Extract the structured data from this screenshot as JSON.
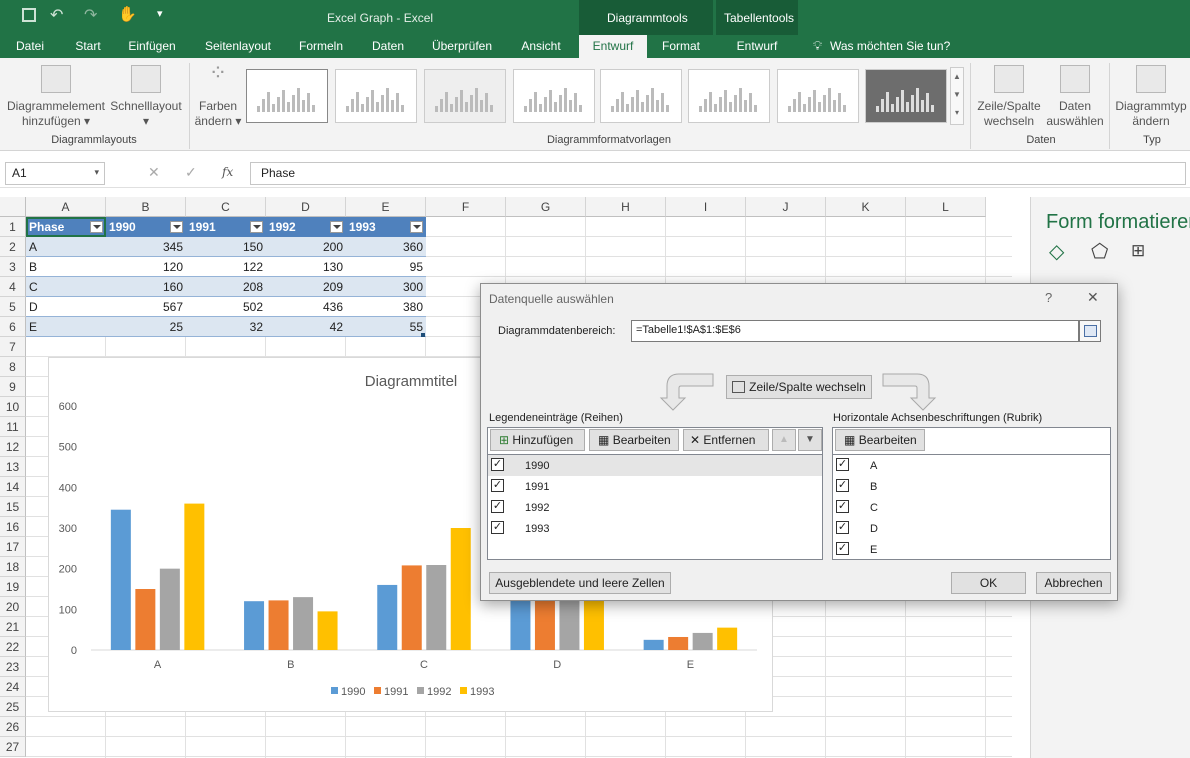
{
  "titlebar": {
    "doc_title": "Excel Graph - Excel",
    "ctx_diagram": "Diagrammtools",
    "ctx_table": "Tabellentools"
  },
  "tabs": [
    "Datei",
    "Start",
    "Einfügen",
    "Seitenlayout",
    "Formeln",
    "Daten",
    "Überprüfen",
    "Ansicht",
    "Entwurf",
    "Format",
    "Entwurf"
  ],
  "search": "Was möchten Sie tun?",
  "ribbon": {
    "add_element": "Diagrammelement",
    "add_element2": "hinzufügen",
    "quick_layout": "Schnelllayout",
    "group_layouts": "Diagrammlayouts",
    "colors": "Farben",
    "colors2": "ändern",
    "group_styles": "Diagrammformatvorlagen",
    "switch_rc": "Zeile/Spalte",
    "switch_rc2": "wechseln",
    "select_data": "Daten",
    "select_data2": "auswählen",
    "group_data": "Daten",
    "change_type": "Diagrammtyp",
    "change_type2": "ändern",
    "group_type": "Typ"
  },
  "formula": {
    "namebox": "A1",
    "fx": "fx",
    "value": "Phase"
  },
  "columns": [
    "A",
    "B",
    "C",
    "D",
    "E",
    "F",
    "G",
    "H",
    "I",
    "J",
    "K",
    "L"
  ],
  "rows": [
    "1",
    "2",
    "3",
    "4",
    "5",
    "6",
    "7",
    "8",
    "9",
    "10",
    "11",
    "12",
    "13",
    "14",
    "15",
    "16",
    "17",
    "18",
    "19",
    "20",
    "21",
    "22",
    "23",
    "24",
    "25",
    "26",
    "27"
  ],
  "table": {
    "headers": [
      "Phase",
      "1990",
      "1991",
      "1992",
      "1993"
    ],
    "rows": [
      [
        "A",
        "345",
        "150",
        "200",
        "360"
      ],
      [
        "B",
        "120",
        "122",
        "130",
        "95"
      ],
      [
        "C",
        "160",
        "208",
        "209",
        "300"
      ],
      [
        "D",
        "567",
        "502",
        "436",
        "380"
      ],
      [
        "E",
        "25",
        "32",
        "42",
        "55"
      ]
    ]
  },
  "chart_data": {
    "type": "bar",
    "title": "Diagrammtitel",
    "categories": [
      "A",
      "B",
      "C",
      "D",
      "E"
    ],
    "series": [
      {
        "name": "1990",
        "color": "#5b9bd5",
        "values": [
          345,
          120,
          160,
          567,
          25
        ]
      },
      {
        "name": "1991",
        "color": "#ed7d31",
        "values": [
          150,
          122,
          208,
          502,
          32
        ]
      },
      {
        "name": "1992",
        "color": "#a5a5a5",
        "values": [
          200,
          130,
          209,
          436,
          42
        ]
      },
      {
        "name": "1993",
        "color": "#ffc000",
        "values": [
          360,
          95,
          300,
          380,
          55
        ]
      }
    ],
    "yticks": [
      "0",
      "100",
      "200",
      "300",
      "400",
      "500",
      "600"
    ],
    "ylim": [
      0,
      600
    ],
    "legend_position": "bottom",
    "grid": false
  },
  "pane": {
    "title": "Form formatieren"
  },
  "dialog": {
    "title": "Datenquelle auswählen",
    "help": "?",
    "close": "✕",
    "range_label": "Diagrammdatenbereich:",
    "range_value": "=Tabelle1!$A$1:$E$6",
    "switch_btn": "Zeile/Spalte wechseln",
    "legend_label": "Legendeneinträge (Reihen)",
    "add": "Hinzufügen",
    "edit": "Bearbeiten",
    "remove": "Entfernen",
    "series": [
      "1990",
      "1991",
      "1992",
      "1993"
    ],
    "axis_label": "Horizontale Achsenbeschriftungen (Rubrik)",
    "axis_edit": "Bearbeiten",
    "categories": [
      "A",
      "B",
      "C",
      "D",
      "E"
    ],
    "hidden_btn": "Ausgeblendete und leere Zellen",
    "ok": "OK",
    "cancel": "Abbrechen"
  }
}
